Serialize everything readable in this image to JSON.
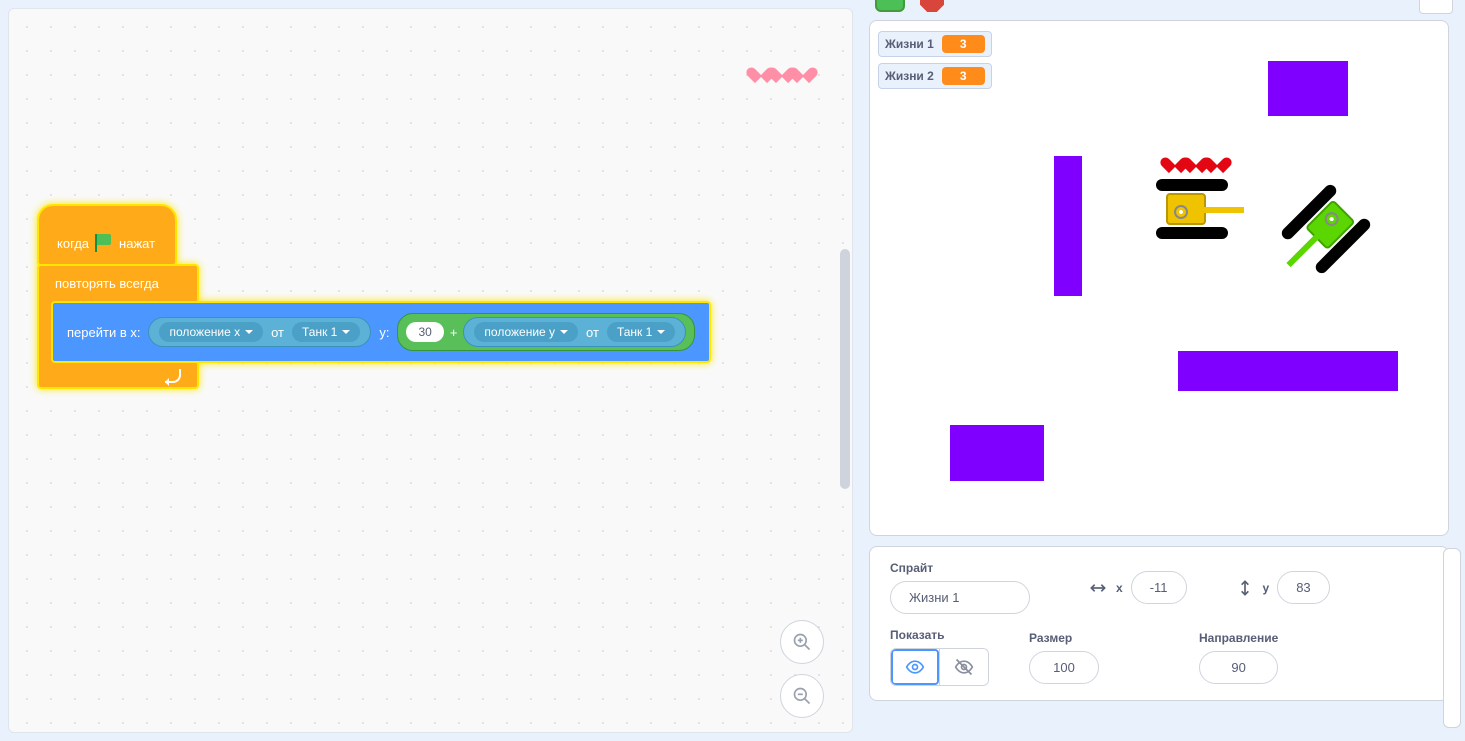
{
  "colors": {
    "accent": "#4c97ff",
    "events": "#ffab19",
    "operators": "#59c059",
    "sensing": "#5cb1d6",
    "variable": "#ff8c1a"
  },
  "scripts": {
    "hat": {
      "prefix": "когда",
      "suffix": "нажат"
    },
    "forever": {
      "label": "повторять всегда"
    },
    "goto": {
      "label_x": "перейти в x:",
      "label_y": "y:",
      "sensing_x": {
        "attr": "положение x",
        "of": "от",
        "target": "Танк 1"
      },
      "sensing_y": {
        "attr": "положение y",
        "of": "от",
        "target": "Танк 1"
      },
      "add_const": "30",
      "plus": "+"
    }
  },
  "stage": {
    "var1": {
      "label": "Жизни 1",
      "value": "3"
    },
    "var2": {
      "label": "Жизни 2",
      "value": "3"
    }
  },
  "sprite_info": {
    "header": "Спрайт",
    "name": "Жизни 1",
    "x_label": "x",
    "x": "-11",
    "y_label": "y",
    "y": "83",
    "show_label": "Показать",
    "size_label": "Размер",
    "size": "100",
    "dir_label": "Направление",
    "dir": "90"
  }
}
